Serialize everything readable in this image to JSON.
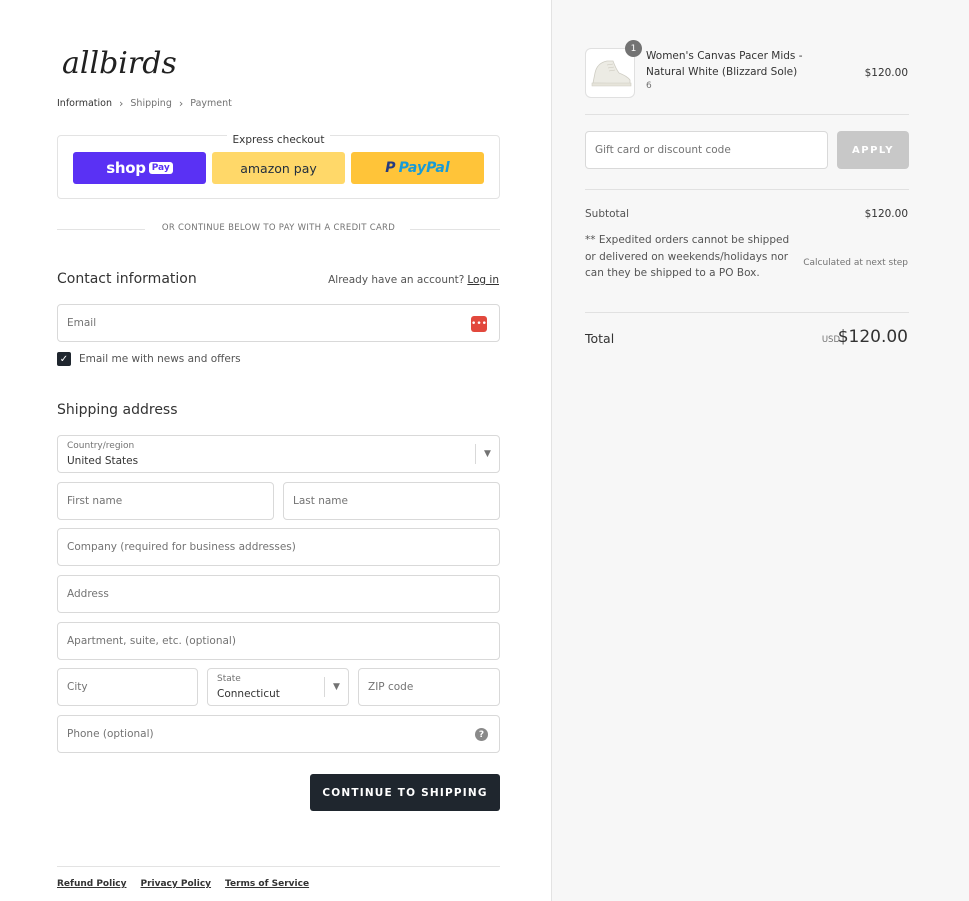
{
  "brand": {
    "logo_text": "allbirds"
  },
  "breadcrumb": [
    "Information",
    "Shipping",
    "Payment"
  ],
  "express": {
    "title": "Express checkout",
    "shop_pay": "shop",
    "shop_pay_badge": "Pay",
    "amazon_pay": "amazon pay",
    "paypal": "PayPal"
  },
  "divider_text": "OR CONTINUE BELOW TO PAY WITH A CREDIT CARD",
  "contact": {
    "title": "Contact information",
    "account_prompt": "Already have an account?",
    "login_link": "Log in",
    "email_placeholder": "Email",
    "newsletter_label": "Email me with news and offers",
    "newsletter_checked": true
  },
  "shipping": {
    "title": "Shipping address",
    "country_label": "Country/region",
    "country_value": "United States",
    "first_name": "First name",
    "last_name": "Last name",
    "company": "Company (required for business addresses)",
    "address": "Address",
    "apartment": "Apartment, suite, etc. (optional)",
    "city": "City",
    "state_label": "State",
    "state_value": "Connecticut",
    "zip": "ZIP code",
    "phone": "Phone (optional)"
  },
  "continue_button": "CONTINUE TO SHIPPING",
  "footer_links": [
    "Refund Policy",
    "Privacy Policy",
    "Terms of Service"
  ],
  "summary": {
    "product": {
      "quantity": "1",
      "name": "Women's Canvas Pacer Mids - Natural White (Blizzard Sole)",
      "variant": "6",
      "price": "$120.00"
    },
    "discount_placeholder": "Gift card or discount code",
    "apply_label": "APPLY",
    "subtotal_label": "Subtotal",
    "subtotal_value": "$120.00",
    "shipping_note": "** Expedited orders cannot be shipped or delivered on weekends/holidays nor can they be shipped to a PO Box.",
    "shipping_value": "Calculated at next step",
    "total_label": "Total",
    "currency": "USD",
    "total_value": "$120.00"
  },
  "colors": {
    "shop_pay": "#5a31f4",
    "amazon_pay": "#ffd869",
    "paypal": "#ffc439",
    "primary_button": "#1f262e",
    "email_icon": "#e2483d",
    "sidebar_bg": "#f7f7f7"
  }
}
